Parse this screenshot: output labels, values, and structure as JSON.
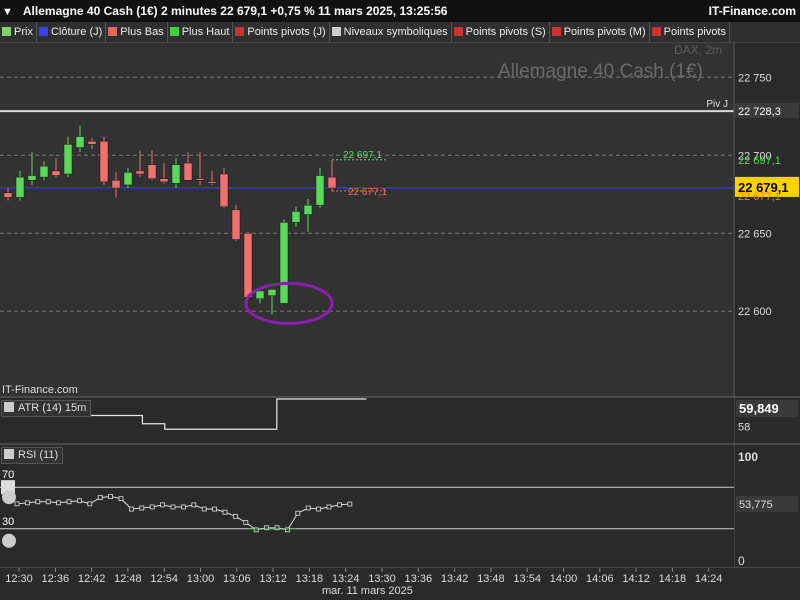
{
  "header": {
    "title": "Allemagne 40 Cash (1€) 2 minutes 22 679,1 +0,75 % 11 mars 2025, 13:25:56",
    "brand": "IT-Finance.com"
  },
  "legend_items": [
    {
      "label": "Prix",
      "color": "#7fd46f"
    },
    {
      "label": "Clôture (J)",
      "color": "#3344ee"
    },
    {
      "label": "Plus Bas",
      "color": "#e06666"
    },
    {
      "label": "Plus Haut",
      "color": "#44cc44"
    },
    {
      "label": "Points pivots (J)",
      "color": "#cc3333"
    },
    {
      "label": "Niveaux symboliques",
      "color": "#cccccc"
    },
    {
      "label": "Points pivots (S)",
      "color": "#cc3333"
    },
    {
      "label": "Points pivots (M)",
      "color": "#cc3333"
    },
    {
      "label": "Points pivots",
      "color": "#cc3333"
    }
  ],
  "colors": {
    "up": "#59d959",
    "down": "#f07070",
    "close_line": "#3344ee",
    "highlight": "#8a1fb0"
  },
  "chart_data": {
    "type": "candlestick",
    "watermark": "Allemagne 40 Cash (1€)",
    "watermark_sub": "DAX, 2m",
    "source_text": "IT-Finance.com",
    "y_ticks": [
      "22 750",
      "22 700",
      "22 650",
      "22 600"
    ],
    "y_tick_values": [
      22750,
      22700,
      22650,
      22600
    ],
    "ylim": [
      22545,
      22772
    ],
    "grid": true,
    "x_ticks": [
      "12:30",
      "12:36",
      "12:42",
      "12:48",
      "12:54",
      "13:00",
      "13:06",
      "13:12",
      "13:18",
      "13:24",
      "13:30",
      "13:36",
      "13:42",
      "13:48",
      "13:54",
      "14:00",
      "14:06",
      "14:12",
      "14:18",
      "14:24"
    ],
    "x_date_label": "mar. 11 mars 2025",
    "current_price": "22 679,1",
    "current_price_value": 22679.1,
    "close_prev_value": 22679.1,
    "pivot": {
      "label": "Piv J",
      "value_text": "22 728,3",
      "value": 22728.3
    },
    "high_label": "22 697,1",
    "high_value": 22697.1,
    "low_label": "22 677,1",
    "low_value": 22677.1,
    "candles": [
      {
        "o": 22676,
        "h": 22679,
        "l": 22671,
        "c": 22673
      },
      {
        "o": 22673,
        "h": 22690,
        "l": 22671,
        "c": 22686
      },
      {
        "o": 22684,
        "h": 22702,
        "l": 22681,
        "c": 22687
      },
      {
        "o": 22686,
        "h": 22696,
        "l": 22684,
        "c": 22693
      },
      {
        "o": 22690,
        "h": 22698,
        "l": 22686,
        "c": 22687
      },
      {
        "o": 22688,
        "h": 22712,
        "l": 22686,
        "c": 22707
      },
      {
        "o": 22705,
        "h": 22719,
        "l": 22702,
        "c": 22712
      },
      {
        "o": 22709,
        "h": 22711,
        "l": 22704,
        "c": 22707
      },
      {
        "o": 22709,
        "h": 22712,
        "l": 22681,
        "c": 22683
      },
      {
        "o": 22684,
        "h": 22689,
        "l": 22673,
        "c": 22679
      },
      {
        "o": 22681,
        "h": 22692,
        "l": 22679,
        "c": 22689
      },
      {
        "o": 22690,
        "h": 22703,
        "l": 22686,
        "c": 22688
      },
      {
        "o": 22694,
        "h": 22703,
        "l": 22684,
        "c": 22685
      },
      {
        "o": 22685,
        "h": 22695,
        "l": 22682,
        "c": 22683
      },
      {
        "o": 22682,
        "h": 22698,
        "l": 22679,
        "c": 22694
      },
      {
        "o": 22695,
        "h": 22702,
        "l": 22684,
        "c": 22684
      },
      {
        "o": 22685,
        "h": 22702,
        "l": 22681,
        "c": 22684
      },
      {
        "o": 22683,
        "h": 22690,
        "l": 22681,
        "c": 22682
      },
      {
        "o": 22688,
        "h": 22692,
        "l": 22666,
        "c": 22667
      },
      {
        "o": 22665,
        "h": 22668,
        "l": 22645,
        "c": 22646
      },
      {
        "o": 22650,
        "h": 22651,
        "l": 22608,
        "c": 22609
      },
      {
        "o": 22608,
        "h": 22615,
        "l": 22605,
        "c": 22613
      },
      {
        "o": 22610,
        "h": 22614,
        "l": 22598,
        "c": 22614
      },
      {
        "o": 22605,
        "h": 22659,
        "l": 22605,
        "c": 22657
      },
      {
        "o": 22657,
        "h": 22667,
        "l": 22654,
        "c": 22664
      },
      {
        "o": 22662,
        "h": 22672,
        "l": 22651,
        "c": 22668
      },
      {
        "o": 22668,
        "h": 22692,
        "l": 22666,
        "c": 22687
      },
      {
        "o": 22686,
        "h": 22697,
        "l": 22677,
        "c": 22679
      }
    ],
    "atr": {
      "label": "ATR (14) 15m",
      "value_text": "59,849",
      "tick": "58",
      "tick_value": 58,
      "ylim": [
        55,
        63
      ],
      "values": [
        61.5,
        61.5,
        60.0,
        60.0,
        60.0,
        60.0,
        58.5,
        57.5,
        57.5,
        57.5,
        57.5,
        57.5,
        63.0,
        63.0,
        63.0,
        63.0
      ]
    },
    "rsi": {
      "label": "RSI (11)",
      "value_text": "53,775",
      "ticks": [
        "100",
        "70",
        "30",
        "0"
      ],
      "tick_values": [
        100,
        70,
        30,
        0
      ],
      "values": [
        54,
        55,
        56,
        56,
        55,
        56,
        57,
        54,
        60,
        61,
        59,
        49,
        50,
        51,
        53,
        51,
        51,
        53,
        49,
        49,
        46,
        42,
        36,
        29,
        31,
        31,
        29,
        45,
        50,
        49,
        51,
        53,
        53.8
      ]
    }
  }
}
